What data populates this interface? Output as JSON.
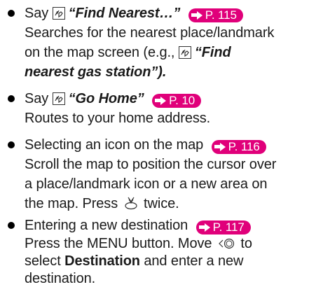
{
  "items": [
    {
      "lead": "Say",
      "command": "“Find Nearest…”",
      "ref": "P. 115",
      "body": [
        "Searches for the nearest place/landmark",
        "on the map screen (e.g.,",
        "nearest gas station”)."
      ],
      "example_command": "“Find"
    },
    {
      "lead": "Say",
      "command": "“Go Home”",
      "ref": "P. 10",
      "body": [
        "Routes to your home address."
      ]
    },
    {
      "title": "Selecting an icon on the map",
      "ref": "P. 116",
      "body": [
        "Scroll the map to position the cursor over",
        "a place/landmark icon or a new area on",
        "the map. Press",
        "twice."
      ]
    },
    {
      "title": "Entering a new destination",
      "ref": "P. 117",
      "body": [
        "Press the MENU button. Move",
        "to",
        "select",
        "Destination",
        "and enter a new",
        "destination."
      ]
    }
  ],
  "icons": {
    "voice": "voice-command-icon",
    "ref": "page-reference-arrow-icon",
    "press": "interface-dial-press-icon",
    "move": "interface-dial-move-icon"
  },
  "colors": {
    "ref_badge": "#e0007a",
    "text": "#1a1a1a"
  }
}
